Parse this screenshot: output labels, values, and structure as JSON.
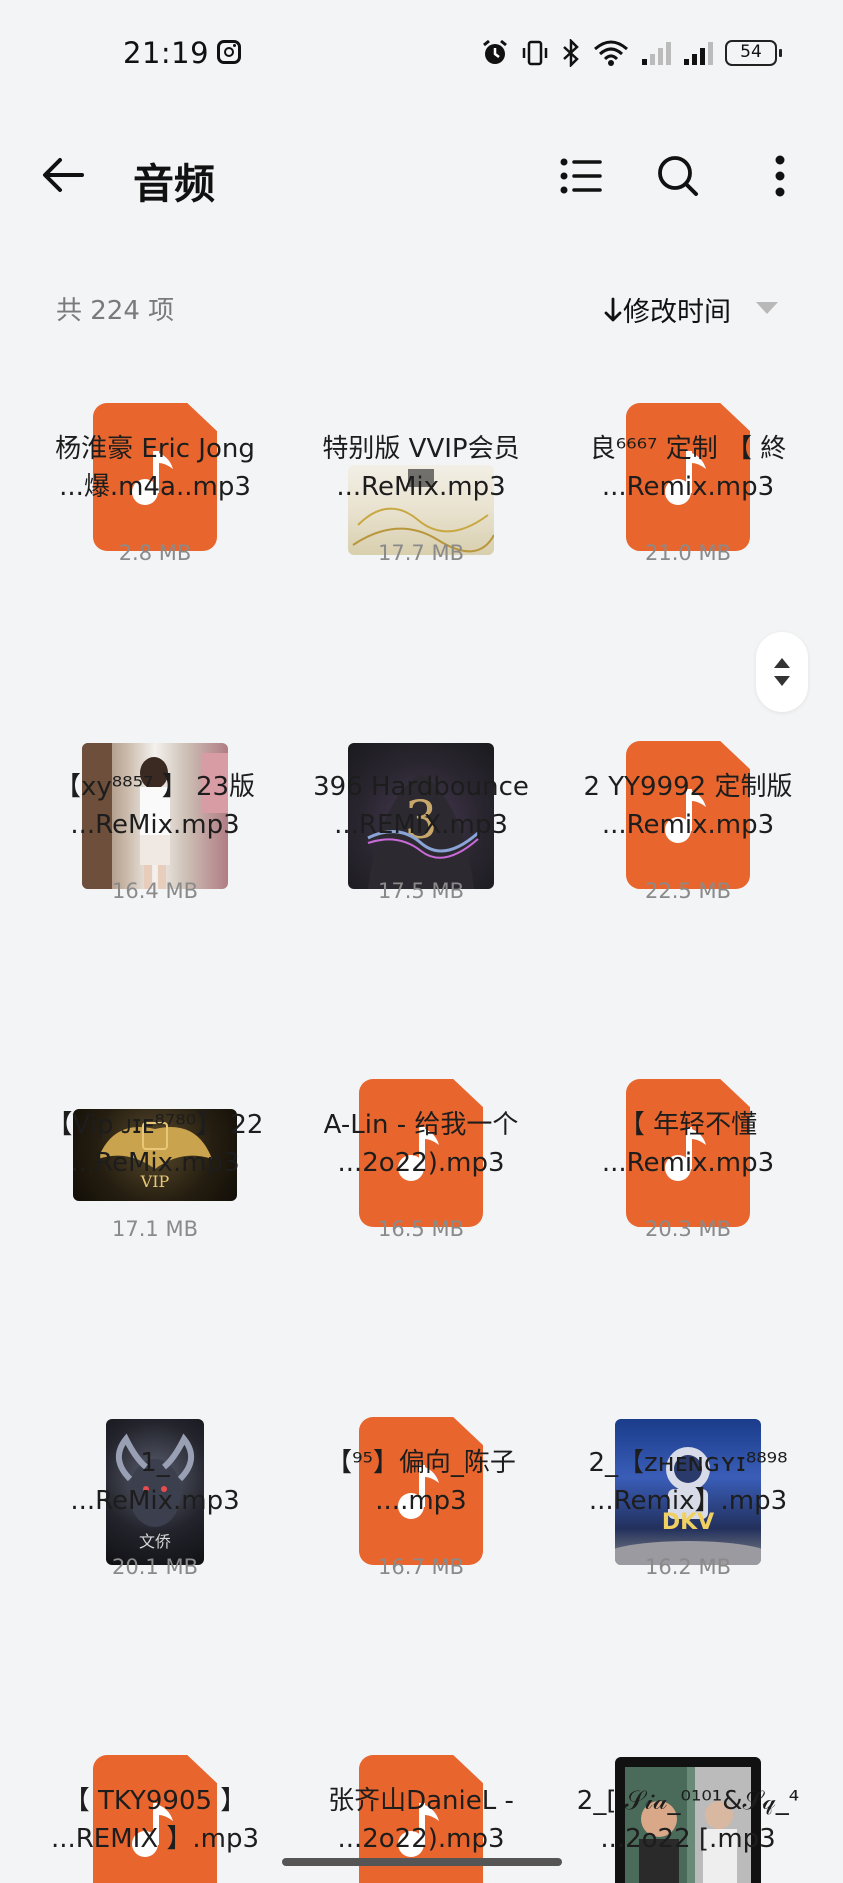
{
  "status_bar": {
    "time": "21:19",
    "battery": "54"
  },
  "header": {
    "title": "音频"
  },
  "subheader": {
    "count": "共 224 项",
    "sort_label": "修改时间"
  },
  "colors": {
    "accent": "#e8662e",
    "background": "#f3f4f6"
  },
  "files": [
    {
      "line1": "杨淮豪 Eric Jong",
      "line2": "...爆.m4a..mp3",
      "size": "2.8 MB",
      "thumb": "music-icon"
    },
    {
      "line1": "特别版 VVIP会员",
      "line2": "...ReMix.mp3",
      "size": "17.7 MB",
      "thumb": "album-art-floral"
    },
    {
      "line1": "良⁶⁶⁶⁷ 定制 【 終",
      "line2": "...Remix.mp3",
      "size": "21.0 MB",
      "thumb": "music-icon"
    },
    {
      "line1": "【xy⁸⁸⁵⁷ 】 23版",
      "line2": "...ReMix.mp3",
      "size": "16.4 MB",
      "thumb": "album-art-photo"
    },
    {
      "line1": "396 Hardbounce",
      "line2": "...REMIX.mp3",
      "size": "17.5 MB",
      "thumb": "album-art-hood"
    },
    {
      "line1": "2 YY9992 定制版",
      "line2": "...Remix.mp3",
      "size": "22.5 MB",
      "thumb": "music-icon"
    },
    {
      "line1": "【Vip ᴊɪᴇ⁸⁷⁸⁰】 22",
      "line2": "...ReMix.mp3",
      "size": "17.1 MB",
      "thumb": "album-art-vip"
    },
    {
      "line1": "A-Lin - 给我一个",
      "line2": "...2o22).mp3",
      "size": "16.5 MB",
      "thumb": "music-icon"
    },
    {
      "line1": "【 年轻不懂",
      "line2": "...Remix.mp3",
      "size": "20.3 MB",
      "thumb": "music-icon"
    },
    {
      "line1": "1_",
      "line2": "...ReMix.mp3",
      "size": "20.1 MB",
      "thumb": "album-art-ram"
    },
    {
      "line1": "【⁹⁵】偏向_陈子",
      "line2": "....mp3",
      "size": "16.7 MB",
      "thumb": "music-icon"
    },
    {
      "line1": "2_【ᴢʜᴇɴɢʏɪ⁸⁸⁹⁸",
      "line2": "...Remix】.mp3",
      "size": "16.2 MB",
      "thumb": "album-art-astronaut"
    },
    {
      "line1": "【 TKY9905 】",
      "line2": "...REMIX 】.mp3",
      "size": "",
      "thumb": "music-icon"
    },
    {
      "line1": "张齐山DanieL -",
      "line2": "...2o22).mp3",
      "size": "",
      "thumb": "music-icon"
    },
    {
      "line1": "2_[ 𝒮𝒾𝒶_⁰¹⁰¹&𝒮𝓆_⁴",
      "line2": "...2o22 [.mp3",
      "size": "",
      "thumb": "album-art-selfie"
    }
  ]
}
